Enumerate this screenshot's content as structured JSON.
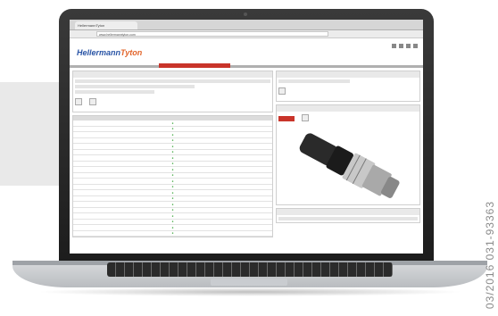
{
  "side_code": "03/2016 031-93363",
  "browser": {
    "tab_title": "HellermannTyton",
    "url": "www.hellermanntyton.com"
  },
  "site": {
    "logo_main": "Hellermann",
    "logo_accent": "Tyton"
  },
  "spec_rows": [
    "",
    "",
    "",
    "",
    "",
    "",
    "",
    "",
    "",
    "",
    "",
    "",
    "",
    "",
    "",
    "",
    "",
    "",
    "",
    ""
  ]
}
